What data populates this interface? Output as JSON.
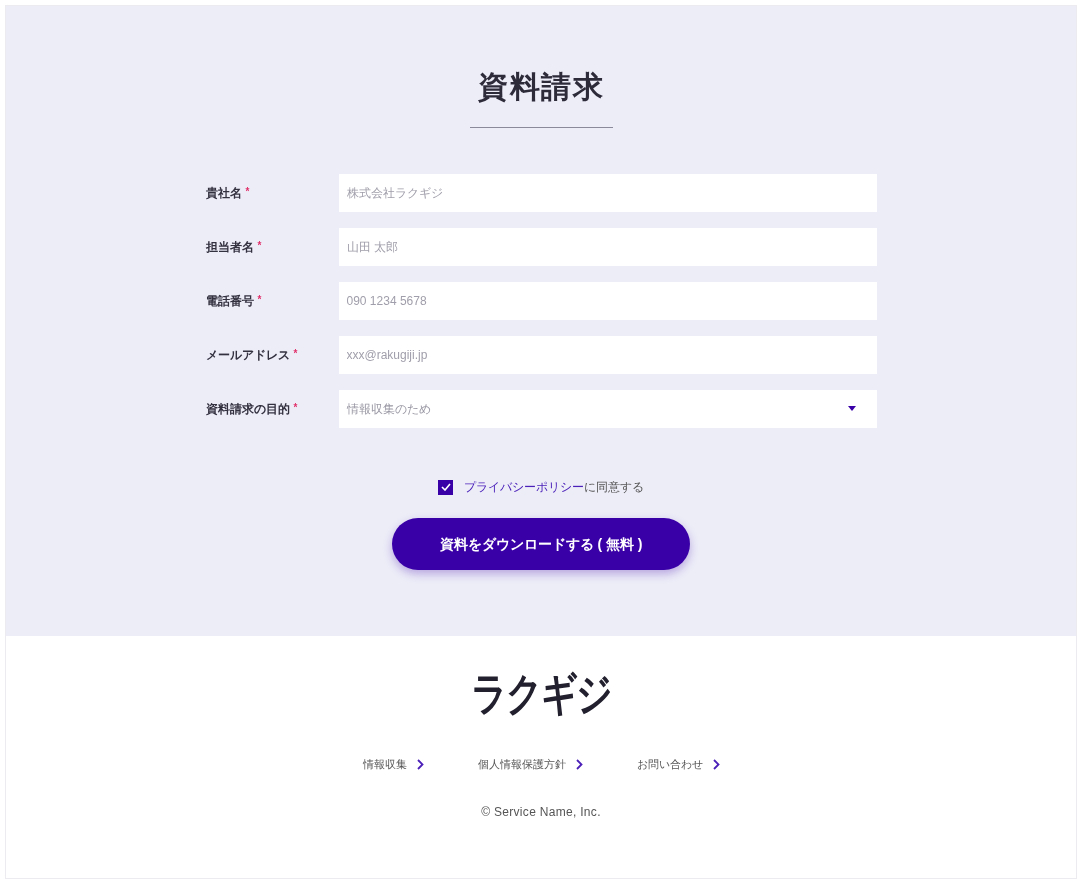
{
  "title": "資料請求",
  "fields": [
    {
      "kind": "text",
      "label": "貴社名",
      "required_mark": "*",
      "placeholder": "株式会社ラクギジ"
    },
    {
      "kind": "text",
      "label": "担当者名",
      "required_mark": "*",
      "placeholder": "山田 太郎"
    },
    {
      "kind": "text",
      "label": "電話番号",
      "required_mark": "*",
      "placeholder": "090 1234 5678"
    },
    {
      "kind": "text",
      "label": "メールアドレス",
      "required_mark": "*",
      "placeholder": "xxx@rakugiji.jp"
    },
    {
      "kind": "select",
      "label": "資料請求の目的",
      "required_mark": "*",
      "value": "情報収集のため"
    }
  ],
  "consent": {
    "checked": true,
    "link": "プライバシーポリシー",
    "text": "に同意する"
  },
  "submit": "資料をダウンロードする ( 無料 )",
  "footer": {
    "logo": "ラクギジ",
    "links": [
      "情報収集",
      "個人情報保護方針",
      "お問い合わせ"
    ],
    "copyright": "© Service Name, Inc."
  }
}
